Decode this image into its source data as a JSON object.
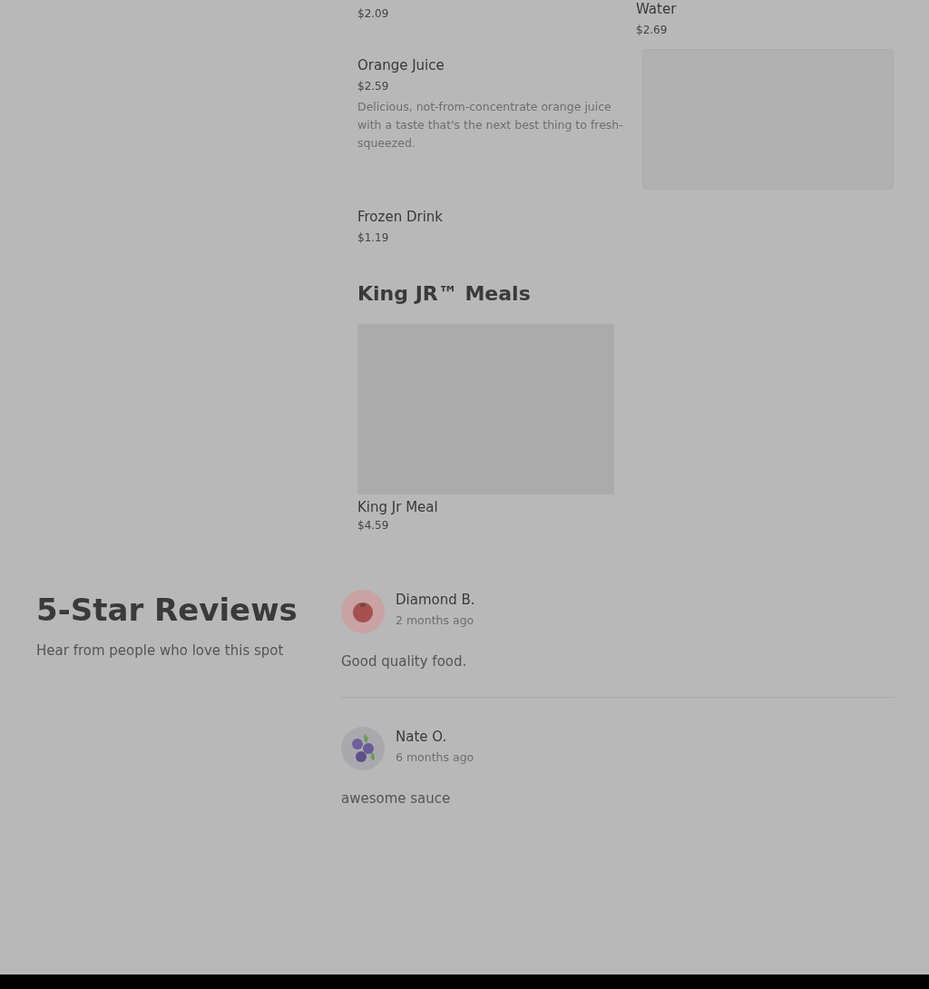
{
  "menu_sections": [
    {
      "items": [
        {
          "kind": "plain",
          "price": "$2.09"
        },
        {
          "kind": "plain",
          "name": "Water",
          "price": "$2.69"
        },
        {
          "kind": "with-image",
          "name": "Orange Juice",
          "price": "$2.59",
          "description": "Delicious, not-from-concentrate orange juice with a taste that's the next best thing to fresh-squeezed."
        },
        {
          "kind": "plain",
          "name": "Frozen Drink",
          "price": "$1.19"
        }
      ]
    },
    {
      "title": "King JR™ Meals",
      "items": [
        {
          "kind": "image-top",
          "name": "King Jr Meal",
          "price": "$4.59"
        }
      ]
    }
  ],
  "reviews": {
    "title": "5-Star Reviews",
    "subtitle": "Hear from people who love this spot",
    "items": [
      {
        "name": "Diamond B.",
        "time": "2 months ago",
        "text": "Good quality food."
      },
      {
        "name": "Nate O.",
        "time": "6 months ago",
        "text": "awesome sauce"
      }
    ]
  }
}
